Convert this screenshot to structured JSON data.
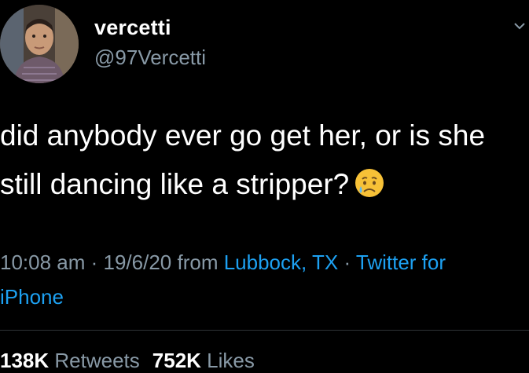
{
  "tweet": {
    "display_name": "vercetti",
    "handle": "@97Vercetti",
    "text_line1": "did anybody ever go get her, or is she",
    "text_line2": "still dancing like a stripper?",
    "emoji_icon": "sad-but-relieved-face-icon",
    "time": "10:08 am",
    "separator": " · ",
    "date": "19/6/20",
    "from_label": " from ",
    "location": "Lubbock, TX",
    "client_part1": "Twitter for",
    "client_part2": "iPhone",
    "retweets_count": "138K",
    "retweets_label": "Retweets",
    "likes_count": "752K",
    "likes_label": "Likes"
  },
  "colors": {
    "background": "#000000",
    "text": "#ffffff",
    "secondary": "#8899a6",
    "link": "#1da1f2"
  }
}
